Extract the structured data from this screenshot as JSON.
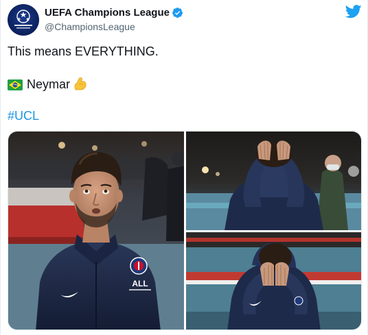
{
  "account": {
    "display_name": "UEFA Champions League",
    "handle": "@ChampionsLeague",
    "avatar_icon": "champions-league-starball-icon",
    "verified_icon": "verified-badge-icon"
  },
  "platform_icon": "twitter-bird-icon",
  "tweet": {
    "line1": "This means EVERYTHING.",
    "line2_flag_icon": "brazil-flag-emoji",
    "line2_text": "Neymar",
    "line2_emoji_icon": "flexed-biceps-emoji",
    "hashtag": "#UCL"
  },
  "media": {
    "photos": [
      {
        "subject": "player-seated-looking-up"
      },
      {
        "subject": "player-head-in-hands-stadium"
      },
      {
        "subject": "player-crouched-face-in-hands"
      }
    ],
    "jacket_crest_text": "ALL"
  },
  "colors": {
    "link": "#1b95e0",
    "verified": "#1d9bf0",
    "twitter_blue": "#1da1f2",
    "text_secondary": "#536471",
    "jacket_navy": "#1e2a4a"
  }
}
